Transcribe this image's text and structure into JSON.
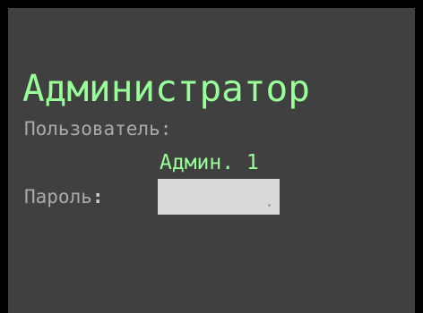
{
  "login": {
    "title": "Администратор",
    "user_label": "Пользователь:",
    "user_value": "Админ. 1",
    "password_label": "Пароль",
    "password_colon": ":",
    "password_value": ""
  },
  "colors": {
    "background": "#404040",
    "border": "#000000",
    "accent_text": "#99ff99",
    "label_text": "#aaaaaa",
    "input_background": "#d9d9d9"
  }
}
